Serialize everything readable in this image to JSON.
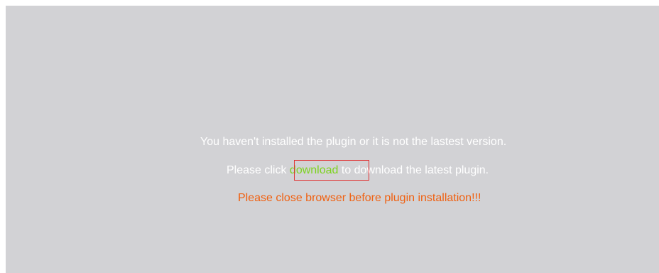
{
  "plugin_notice": {
    "line1": "You haven't installed the plugin or it is not the lastest version.",
    "line2_prefix": "Please click ",
    "download_label": "download",
    "line2_suffix": " to download the latest plugin.",
    "line3": "Please close browser before plugin installation!!!"
  },
  "colors": {
    "panel_bg": "#d2d2d5",
    "text": "#ffffff",
    "link": "#7ed321",
    "warning": "#f06010",
    "highlight_border": "#e03030"
  }
}
